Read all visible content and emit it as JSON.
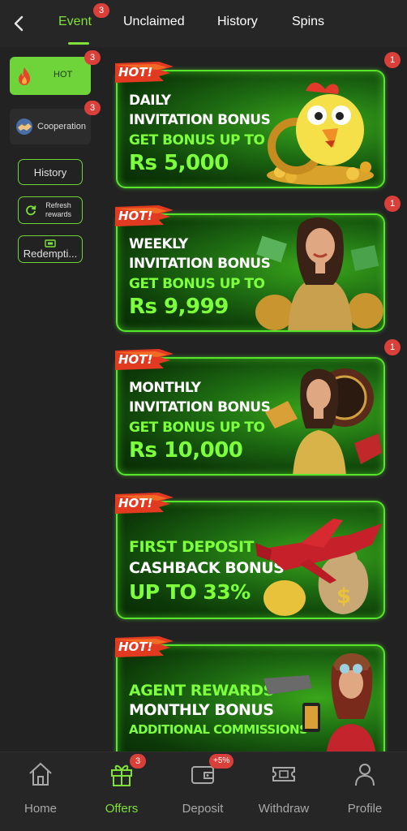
{
  "tabs": [
    {
      "label": "Event",
      "badge": "3"
    },
    {
      "label": "Unclaimed"
    },
    {
      "label": "History"
    },
    {
      "label": "Spins"
    }
  ],
  "sidebar": {
    "hot_label": "HOT",
    "hot_badge": "3",
    "coop_label": "Cooperation",
    "coop_badge": "3",
    "history_label": "History",
    "refresh_label_1": "Refresh",
    "refresh_label_2": "rewards",
    "redeem_label": "Redempti..."
  },
  "banners": [
    {
      "tag": "HOT!",
      "notif": "1",
      "line1": "DAILY",
      "line2": "INVITATION BONUS",
      "line3": "GET BONUS UP TO",
      "line4": "Rs 5,000"
    },
    {
      "tag": "HOT!",
      "notif": "1",
      "line1": "WEEKLY",
      "line2": "INVITATION BONUS",
      "line3": "GET BONUS UP TO",
      "line4": "Rs 9,999"
    },
    {
      "tag": "HOT!",
      "notif": "1",
      "line1": "MONTHLY",
      "line2": "INVITATION BONUS",
      "line3": "GET BONUS UP TO",
      "line4": "Rs 10,000"
    },
    {
      "tag": "HOT!",
      "line1": "FIRST DEPOSIT",
      "line2": "CASHBACK BONUS",
      "line3": "UP TO 33%"
    },
    {
      "tag": "HOT!",
      "line1": "AGENT REWARDS",
      "line2": "MONTHLY BONUS",
      "line3": "ADDITIONAL COMMISSIONS"
    }
  ],
  "nav": [
    {
      "label": "Home",
      "icon": "home-icon"
    },
    {
      "label": "Offers",
      "icon": "gift-icon",
      "badge": "3"
    },
    {
      "label": "Deposit",
      "icon": "wallet-icon",
      "badge": "+5%"
    },
    {
      "label": "Withdraw",
      "icon": "ticket-icon"
    },
    {
      "label": "Profile",
      "icon": "person-icon"
    }
  ],
  "colors": {
    "accent": "#7fe03a",
    "badge": "#d9403a",
    "banner_border": "#57e62b"
  }
}
